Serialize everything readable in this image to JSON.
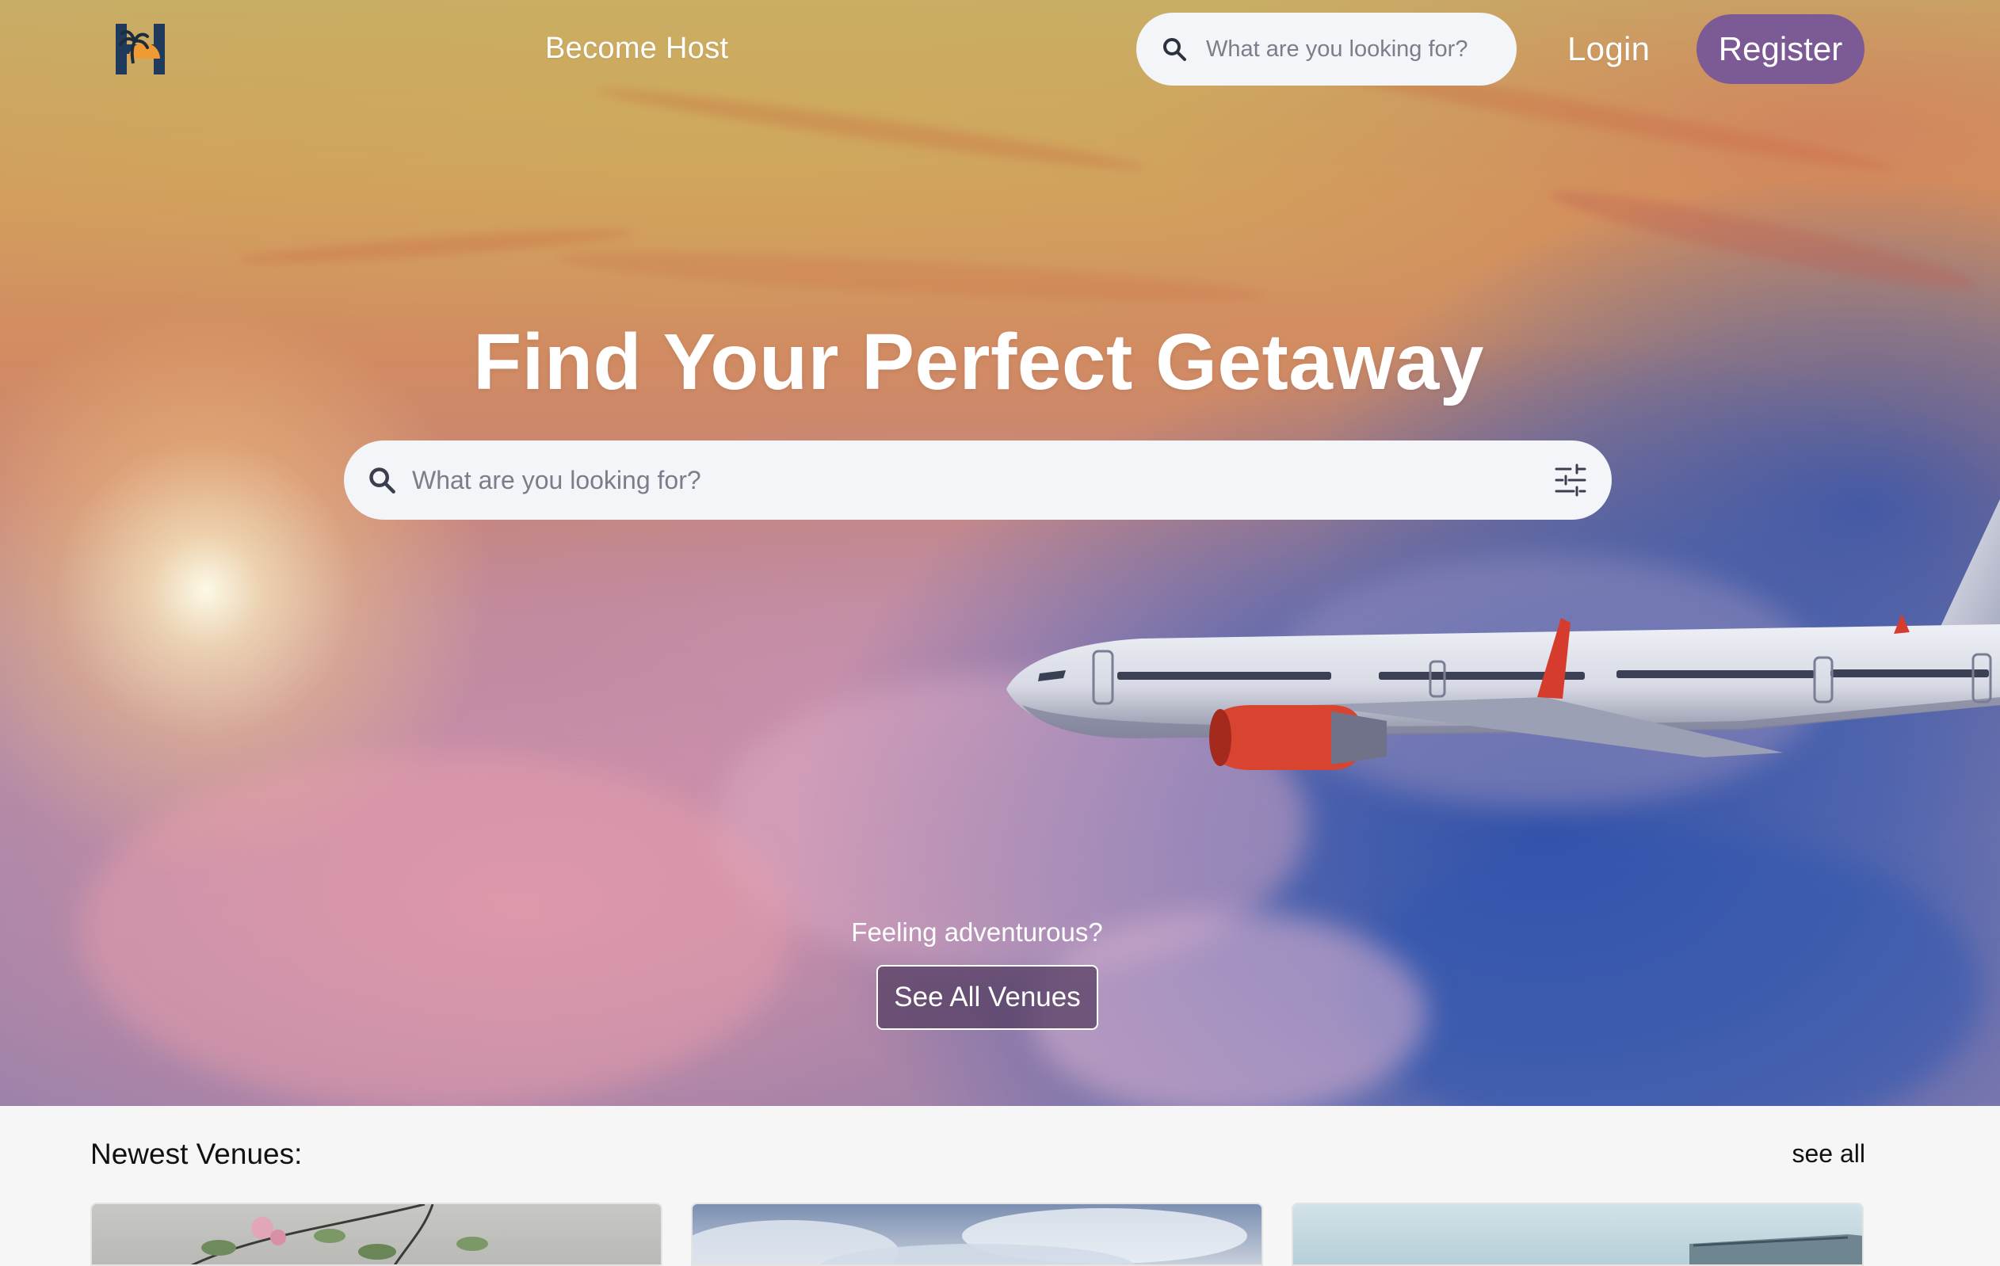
{
  "nav": {
    "logo_label": "H",
    "become_host": "Become Host",
    "search_placeholder": "What are you looking for?",
    "login": "Login",
    "register": "Register"
  },
  "hero": {
    "title": "Find Your Perfect Getaway",
    "search_placeholder": "What are you looking for?",
    "adventurous_text": "Feeling adventurous?",
    "see_all_venues": "See All Venues"
  },
  "newest": {
    "title": "Newest Venues:",
    "see_all": "see all",
    "cards": [
      {
        "image": "flower-branch-photo"
      },
      {
        "image": "sky-clouds-photo"
      },
      {
        "image": "building-photo"
      }
    ]
  },
  "colors": {
    "register_bg": "#7b5a95",
    "search_bg": "#f4f5f9",
    "page_bg": "#f6f6f6",
    "logo_navy": "#1f3a5a",
    "logo_orange": "#f09a34"
  },
  "icons": {
    "search": "search-icon",
    "filter": "sliders-icon",
    "logo": "palm-sunset-logo"
  }
}
